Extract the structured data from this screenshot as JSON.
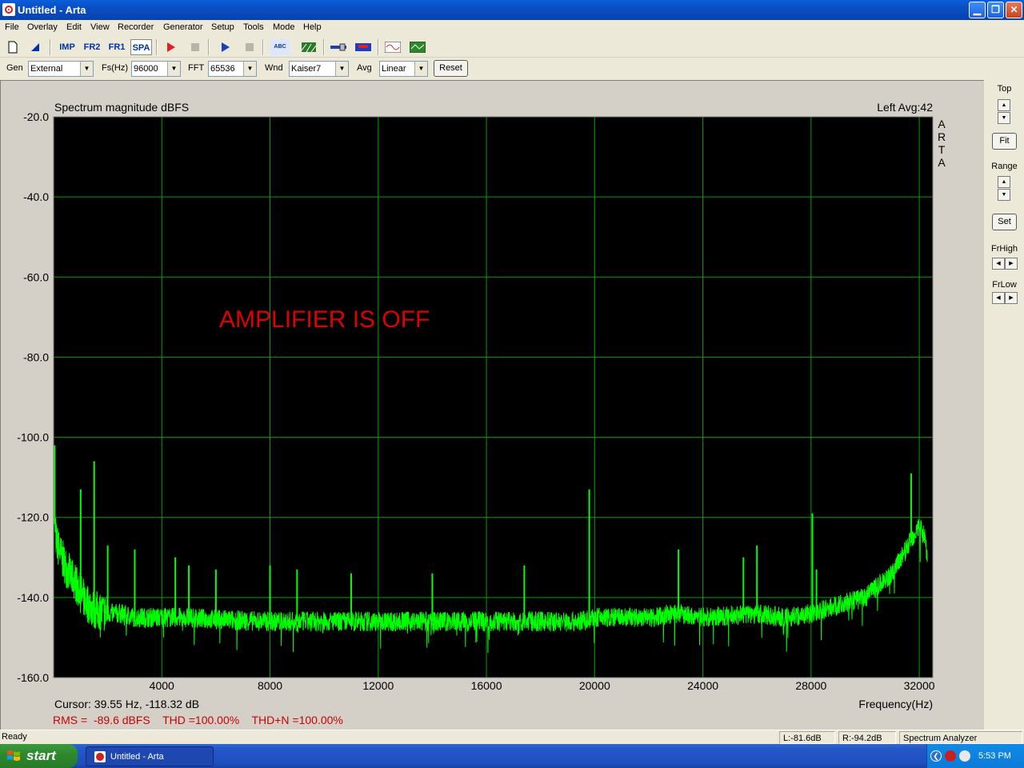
{
  "window": {
    "title": "Untitled - Arta"
  },
  "menu": [
    "File",
    "Overlay",
    "Edit",
    "View",
    "Recorder",
    "Generator",
    "Setup",
    "Tools",
    "Mode",
    "Help"
  ],
  "toolbar": {
    "imp": "IMP",
    "fr2": "FR2",
    "fr1": "FR1",
    "spa": "SPA",
    "abc": "ABC"
  },
  "settings": {
    "gen_label": "Gen",
    "gen_value": "External",
    "fs_label": "Fs(Hz)",
    "fs_value": "96000",
    "fft_label": "FFT",
    "fft_value": "65536",
    "wnd_label": "Wnd",
    "wnd_value": "Kaiser7",
    "avg_label": "Avg",
    "avg_value": "Linear",
    "reset_label": "Reset"
  },
  "right_panel": {
    "top_label": "Top",
    "fit_label": "Fit",
    "range_label": "Range",
    "set_label": "Set",
    "frhigh_label": "FrHigh",
    "frlow_label": "FrLow"
  },
  "plot": {
    "title": "Spectrum magnitude dBFS",
    "channel_info": "Left  Avg:42",
    "logo": "ARTA",
    "annotation": "AMPLIFIER IS OFF",
    "cursor_text": "Cursor: 39.55 Hz, -118.32 dB",
    "xlabel": "Frequency(Hz)",
    "rms_text": "RMS =  -89.6 dBFS    THD =100.00%    THD+N =100.00%"
  },
  "chart_data": {
    "type": "line",
    "title": "Spectrum magnitude dBFS",
    "xlabel": "Frequency(Hz)",
    "ylabel": "",
    "xlim": [
      0,
      32500
    ],
    "ylim": [
      -160,
      -20
    ],
    "x_ticks": [
      4000,
      8000,
      12000,
      16000,
      20000,
      24000,
      28000,
      32000
    ],
    "x_tick_labels": [
      "4000",
      "8000",
      "12000",
      "16000",
      "20000",
      "24000",
      "28000",
      "32000"
    ],
    "y_ticks": [
      -20,
      -40,
      -60,
      -80,
      -100,
      -120,
      -140,
      -160
    ],
    "y_tick_labels": [
      "-20.0",
      "-40.0",
      "-60.0",
      "-80.0",
      "-100.0",
      "-120.0",
      "-140.0",
      "-160.0"
    ],
    "grid": true,
    "line_color": "#00ff00",
    "background": "#000000",
    "grid_color": "#00a000",
    "series": [
      {
        "x": [
          0,
          100,
          300,
          500,
          800,
          1000,
          1200,
          1500,
          2000,
          2500,
          3000,
          4000,
          5000,
          6000,
          8000,
          10000,
          12000,
          14000,
          16000,
          18000,
          19500,
          20000,
          22000,
          23000,
          24000,
          26000,
          27000,
          28000,
          29000,
          30000,
          30500,
          31000,
          31500,
          32000,
          32200,
          32300
        ],
        "y": [
          -118,
          -126,
          -130,
          -133,
          -136,
          -139,
          -141,
          -143,
          -144,
          -144,
          -145,
          -145,
          -145,
          -145.5,
          -146,
          -146,
          -146,
          -146,
          -146,
          -146,
          -146,
          -145,
          -145,
          -144,
          -145,
          -144,
          -145,
          -144,
          -142,
          -140,
          -137,
          -134,
          -128,
          -122,
          -125,
          -130
        ]
      }
    ],
    "peaks": [
      {
        "x": 39.55,
        "y": -102
      },
      {
        "x": 1000,
        "y": -113
      },
      {
        "x": 1500,
        "y": -106
      },
      {
        "x": 2000,
        "y": -127
      },
      {
        "x": 3000,
        "y": -128
      },
      {
        "x": 4500,
        "y": -130
      },
      {
        "x": 5000,
        "y": -132
      },
      {
        "x": 6000,
        "y": -133
      },
      {
        "x": 8000,
        "y": -132
      },
      {
        "x": 9000,
        "y": -133
      },
      {
        "x": 11000,
        "y": -134
      },
      {
        "x": 14000,
        "y": -134
      },
      {
        "x": 17400,
        "y": -132
      },
      {
        "x": 19800,
        "y": -113
      },
      {
        "x": 23100,
        "y": -128
      },
      {
        "x": 25500,
        "y": -130
      },
      {
        "x": 26000,
        "y": -127
      },
      {
        "x": 28050,
        "y": -119
      },
      {
        "x": 28200,
        "y": -133
      },
      {
        "x": 31700,
        "y": -109
      }
    ]
  },
  "statusbar": {
    "ready": "Ready",
    "left_level": "L:-81.6dB",
    "right_level": "R:-94.2dB",
    "mode": "Spectrum Analyzer"
  },
  "taskbar": {
    "start_label": "start",
    "task_label": "Untitled - Arta",
    "clock": "5:53 PM"
  }
}
